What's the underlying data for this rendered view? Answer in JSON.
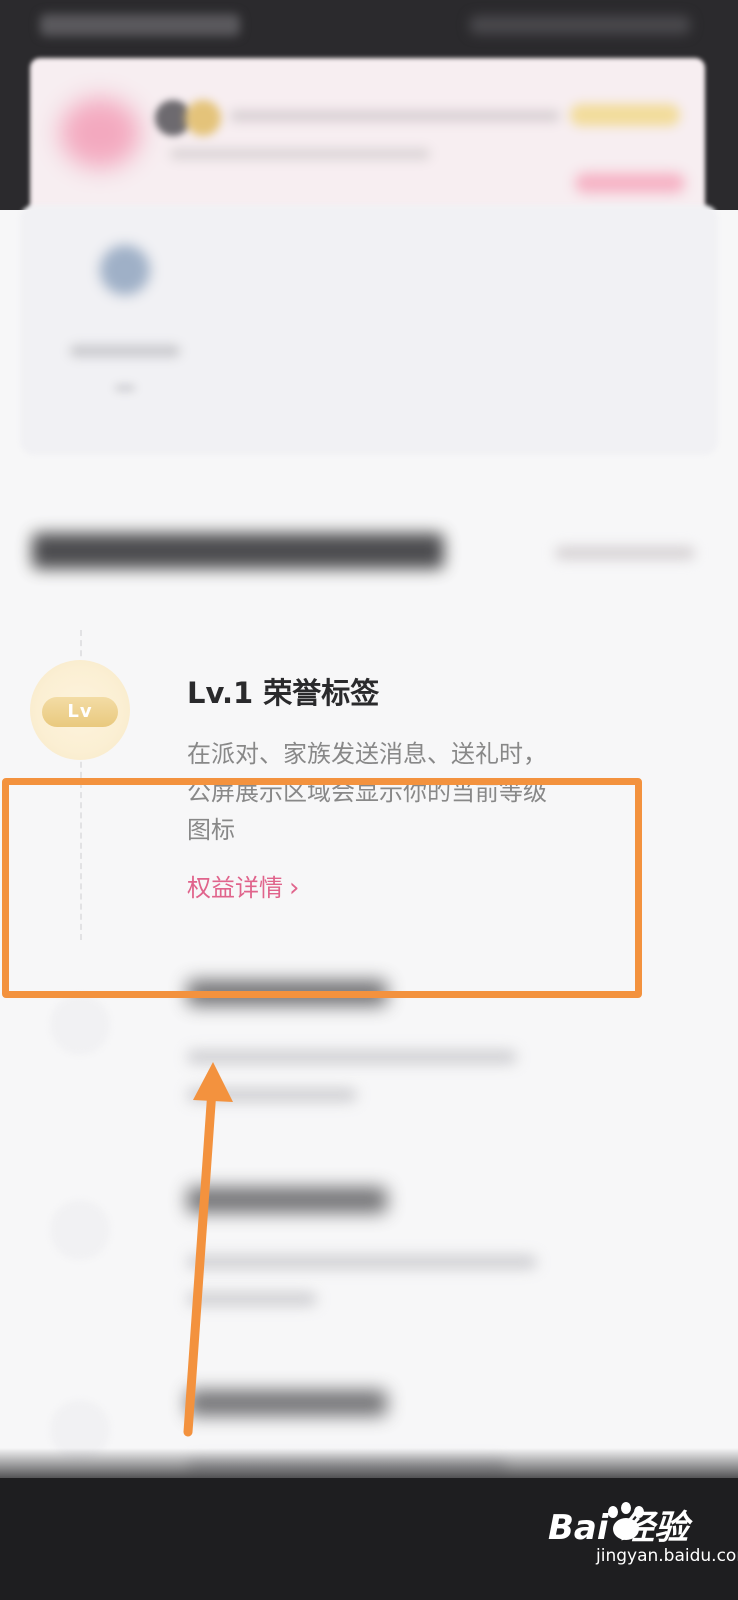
{
  "privilege_item": {
    "badge_text": "Lv",
    "title": "Lv.1 荣誉标签",
    "description": "在派对、家族发送消息、送礼时，公屏展示区域会显示你的当前等级图标",
    "link_label": "权益详情",
    "link_chevron": "›"
  },
  "watermark": {
    "brand_text": "Bai 经验",
    "domain_text": "jingyan.baidu.com"
  },
  "colors": {
    "accent_pink": "#e0648c",
    "highlight_orange": "#f3923e",
    "badge_gold": "#e9c97e"
  }
}
